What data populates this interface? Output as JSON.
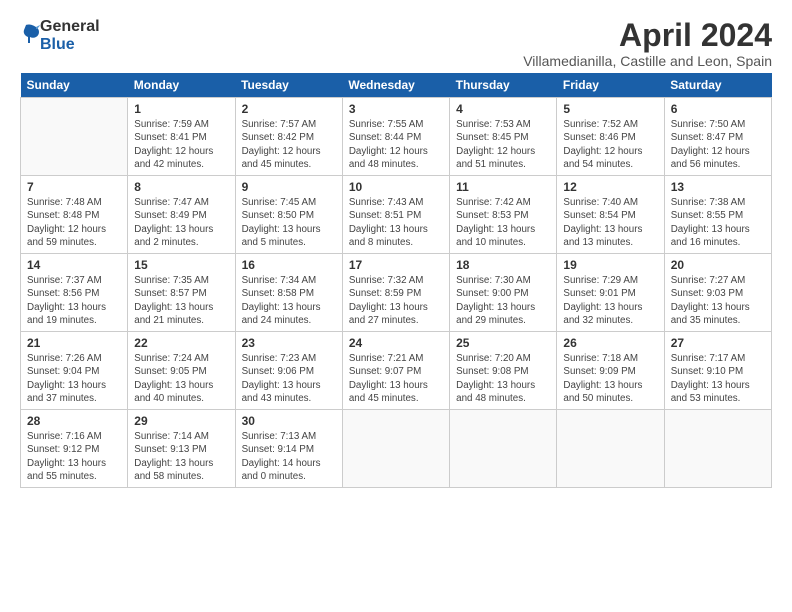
{
  "logo": {
    "general": "General",
    "blue": "Blue"
  },
  "title": "April 2024",
  "subtitle": "Villamedianilla, Castille and Leon, Spain",
  "headers": [
    "Sunday",
    "Monday",
    "Tuesday",
    "Wednesday",
    "Thursday",
    "Friday",
    "Saturday"
  ],
  "weeks": [
    [
      {
        "day": "",
        "info": ""
      },
      {
        "day": "1",
        "info": "Sunrise: 7:59 AM\nSunset: 8:41 PM\nDaylight: 12 hours\nand 42 minutes."
      },
      {
        "day": "2",
        "info": "Sunrise: 7:57 AM\nSunset: 8:42 PM\nDaylight: 12 hours\nand 45 minutes."
      },
      {
        "day": "3",
        "info": "Sunrise: 7:55 AM\nSunset: 8:44 PM\nDaylight: 12 hours\nand 48 minutes."
      },
      {
        "day": "4",
        "info": "Sunrise: 7:53 AM\nSunset: 8:45 PM\nDaylight: 12 hours\nand 51 minutes."
      },
      {
        "day": "5",
        "info": "Sunrise: 7:52 AM\nSunset: 8:46 PM\nDaylight: 12 hours\nand 54 minutes."
      },
      {
        "day": "6",
        "info": "Sunrise: 7:50 AM\nSunset: 8:47 PM\nDaylight: 12 hours\nand 56 minutes."
      }
    ],
    [
      {
        "day": "7",
        "info": "Sunrise: 7:48 AM\nSunset: 8:48 PM\nDaylight: 12 hours\nand 59 minutes."
      },
      {
        "day": "8",
        "info": "Sunrise: 7:47 AM\nSunset: 8:49 PM\nDaylight: 13 hours\nand 2 minutes."
      },
      {
        "day": "9",
        "info": "Sunrise: 7:45 AM\nSunset: 8:50 PM\nDaylight: 13 hours\nand 5 minutes."
      },
      {
        "day": "10",
        "info": "Sunrise: 7:43 AM\nSunset: 8:51 PM\nDaylight: 13 hours\nand 8 minutes."
      },
      {
        "day": "11",
        "info": "Sunrise: 7:42 AM\nSunset: 8:53 PM\nDaylight: 13 hours\nand 10 minutes."
      },
      {
        "day": "12",
        "info": "Sunrise: 7:40 AM\nSunset: 8:54 PM\nDaylight: 13 hours\nand 13 minutes."
      },
      {
        "day": "13",
        "info": "Sunrise: 7:38 AM\nSunset: 8:55 PM\nDaylight: 13 hours\nand 16 minutes."
      }
    ],
    [
      {
        "day": "14",
        "info": "Sunrise: 7:37 AM\nSunset: 8:56 PM\nDaylight: 13 hours\nand 19 minutes."
      },
      {
        "day": "15",
        "info": "Sunrise: 7:35 AM\nSunset: 8:57 PM\nDaylight: 13 hours\nand 21 minutes."
      },
      {
        "day": "16",
        "info": "Sunrise: 7:34 AM\nSunset: 8:58 PM\nDaylight: 13 hours\nand 24 minutes."
      },
      {
        "day": "17",
        "info": "Sunrise: 7:32 AM\nSunset: 8:59 PM\nDaylight: 13 hours\nand 27 minutes."
      },
      {
        "day": "18",
        "info": "Sunrise: 7:30 AM\nSunset: 9:00 PM\nDaylight: 13 hours\nand 29 minutes."
      },
      {
        "day": "19",
        "info": "Sunrise: 7:29 AM\nSunset: 9:01 PM\nDaylight: 13 hours\nand 32 minutes."
      },
      {
        "day": "20",
        "info": "Sunrise: 7:27 AM\nSunset: 9:03 PM\nDaylight: 13 hours\nand 35 minutes."
      }
    ],
    [
      {
        "day": "21",
        "info": "Sunrise: 7:26 AM\nSunset: 9:04 PM\nDaylight: 13 hours\nand 37 minutes."
      },
      {
        "day": "22",
        "info": "Sunrise: 7:24 AM\nSunset: 9:05 PM\nDaylight: 13 hours\nand 40 minutes."
      },
      {
        "day": "23",
        "info": "Sunrise: 7:23 AM\nSunset: 9:06 PM\nDaylight: 13 hours\nand 43 minutes."
      },
      {
        "day": "24",
        "info": "Sunrise: 7:21 AM\nSunset: 9:07 PM\nDaylight: 13 hours\nand 45 minutes."
      },
      {
        "day": "25",
        "info": "Sunrise: 7:20 AM\nSunset: 9:08 PM\nDaylight: 13 hours\nand 48 minutes."
      },
      {
        "day": "26",
        "info": "Sunrise: 7:18 AM\nSunset: 9:09 PM\nDaylight: 13 hours\nand 50 minutes."
      },
      {
        "day": "27",
        "info": "Sunrise: 7:17 AM\nSunset: 9:10 PM\nDaylight: 13 hours\nand 53 minutes."
      }
    ],
    [
      {
        "day": "28",
        "info": "Sunrise: 7:16 AM\nSunset: 9:12 PM\nDaylight: 13 hours\nand 55 minutes."
      },
      {
        "day": "29",
        "info": "Sunrise: 7:14 AM\nSunset: 9:13 PM\nDaylight: 13 hours\nand 58 minutes."
      },
      {
        "day": "30",
        "info": "Sunrise: 7:13 AM\nSunset: 9:14 PM\nDaylight: 14 hours\nand 0 minutes."
      },
      {
        "day": "",
        "info": ""
      },
      {
        "day": "",
        "info": ""
      },
      {
        "day": "",
        "info": ""
      },
      {
        "day": "",
        "info": ""
      }
    ]
  ]
}
